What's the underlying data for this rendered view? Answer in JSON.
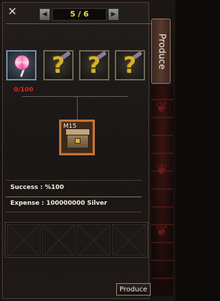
{
  "header": {
    "close_icon": "close-icon",
    "page_indicator": "5 / 6",
    "prev_icon": "triangle-left-icon",
    "next_icon": "triangle-right-icon"
  },
  "materials": [
    {
      "name": "lollipop",
      "icon": "lollipop-icon",
      "count": "0/100"
    },
    {
      "name": "unknown-material",
      "icon": "question-mark-icon"
    },
    {
      "name": "unknown-material",
      "icon": "question-mark-icon"
    },
    {
      "name": "unknown-material",
      "icon": "question-mark-icon"
    }
  ],
  "result": {
    "label": "M15",
    "icon": "treasure-chest-icon"
  },
  "info": {
    "success": "Success : %100",
    "expense": "Expense : 100000000 Silver"
  },
  "side_tab": {
    "label": "Produce"
  },
  "produce_button": {
    "label": "Produce"
  },
  "colors": {
    "count_color": "#e0261c",
    "page_color": "#e6e33a",
    "result_border": "#c4753a"
  }
}
